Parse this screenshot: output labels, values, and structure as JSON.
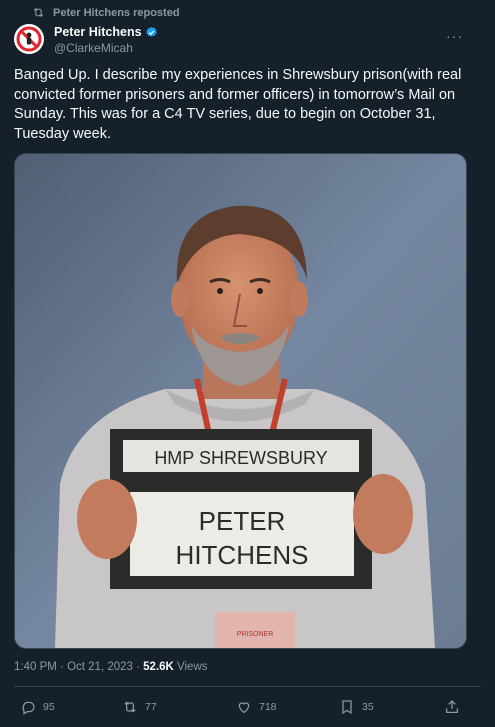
{
  "repost": {
    "text": "Peter Hitchens reposted",
    "icon": "repost-icon"
  },
  "author": {
    "name": "Peter Hitchens",
    "handle": "@ClarkeMicah",
    "verified_icon": "verified-badge-icon"
  },
  "more_icon": "···",
  "tweet": {
    "text": "Banged Up. I describe my experiences in Shrewsbury prison(with real convicted former prisoners and former officers) in tomorrow’s Mail on Sunday. This was for a C4 TV series, due to begin on October 31, Tuesday week."
  },
  "media": {
    "sign_top": "HMP SHREWSBURY",
    "sign_line1": "PETER",
    "sign_line2": "HITCHENS",
    "lanyard_text": "PRISONER"
  },
  "meta": {
    "time": "1:40 PM",
    "sep1": " · ",
    "date": "Oct 21, 2023",
    "sep2": " · ",
    "views_count": "52.6K",
    "views_label": " Views"
  },
  "actions": {
    "replies": "95",
    "reposts": "77",
    "likes": "718",
    "bookmarks": "35"
  },
  "colors": {
    "background": "#15202b",
    "secondary_text": "#8b98a5",
    "verified": "#1d9bf0"
  }
}
